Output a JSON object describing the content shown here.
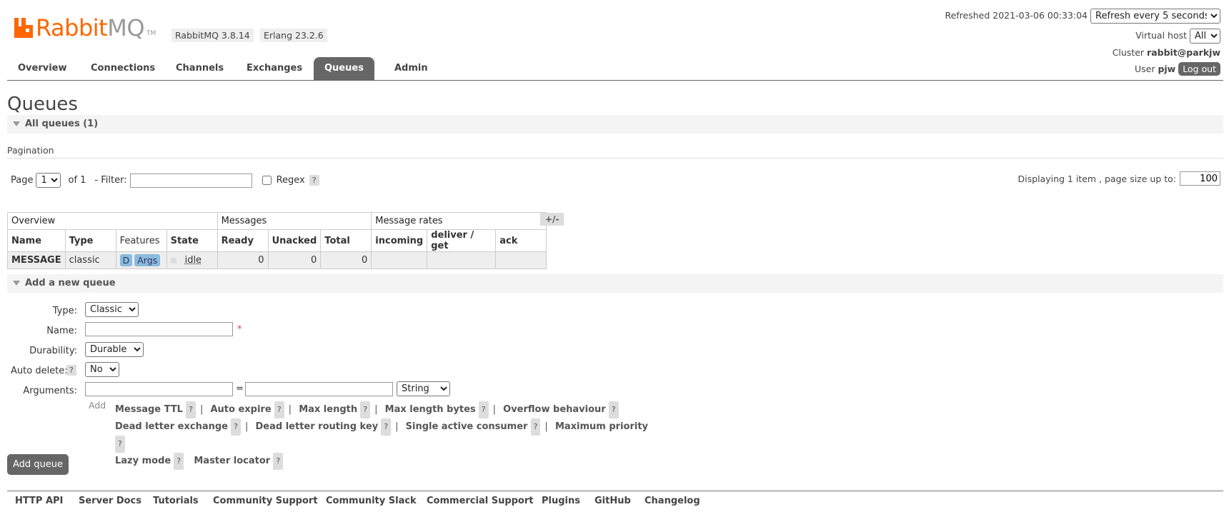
{
  "brand": {
    "rabbit": "Rabbit",
    "mq": "MQ",
    "tm": "TM",
    "primary_color": "#ff6600"
  },
  "versions": {
    "rabbitmq": "RabbitMQ 3.8.14",
    "erlang": "Erlang 23.2.6"
  },
  "header": {
    "refreshed": "Refreshed 2021-03-06 00:33:04",
    "refresh_option": "Refresh every 5 seconds",
    "vhost_label": "Virtual host",
    "vhost_value": "All",
    "cluster_label": "Cluster",
    "cluster_value": "rabbit@parkjw",
    "user_label": "User",
    "user_value": "pjw",
    "logout_label": "Log out"
  },
  "nav": {
    "tabs": [
      {
        "label": "Overview"
      },
      {
        "label": "Connections"
      },
      {
        "label": "Channels"
      },
      {
        "label": "Exchanges"
      },
      {
        "label": "Queues"
      },
      {
        "label": "Admin"
      }
    ],
    "active": "Queues"
  },
  "page": {
    "title": "Queues",
    "all_queues": "All queues (1)"
  },
  "pagination": {
    "section_label": "Pagination",
    "page_label": "Page",
    "page_value": "1",
    "of_label": "of 1",
    "filter_label": "- Filter:",
    "filter_value": "",
    "regex_label": "Regex",
    "help": "?",
    "displaying": "Displaying 1 item , page size up to:",
    "page_size": "100"
  },
  "table": {
    "groups": [
      "Overview",
      "Messages",
      "Message rates"
    ],
    "plusminus": "+/-",
    "headers": [
      "Name",
      "Type",
      "Features",
      "State",
      "Ready",
      "Unacked",
      "Total",
      "incoming",
      "deliver / get",
      "ack"
    ],
    "rows": [
      {
        "name": "MESSAGE",
        "type": "classic",
        "feature_d": "D",
        "feature_args": "Args",
        "state": "idle",
        "ready": "0",
        "unacked": "0",
        "total": "0",
        "incoming": "",
        "deliver_get": "",
        "ack": ""
      }
    ]
  },
  "add_queue": {
    "section_label": "Add a new queue",
    "type_label": "Type:",
    "type_value": "Classic",
    "name_label": "Name:",
    "name_value": "",
    "required_mark": "*",
    "durability_label": "Durability:",
    "durability_value": "Durable",
    "auto_delete_label": "Auto delete:",
    "auto_delete_value": "No",
    "arguments_label": "Arguments:",
    "equals": "=",
    "arg_type_value": "String",
    "add_label": "Add",
    "help": "?",
    "arg_links": [
      "Message TTL",
      "Auto expire",
      "Max length",
      "Max length bytes",
      "Overflow behaviour",
      "Dead letter exchange",
      "Dead letter routing key",
      "Single active consumer",
      "Maximum priority",
      "Lazy mode",
      "Master locator"
    ],
    "separator": "|",
    "submit_label": "Add queue"
  },
  "footer": {
    "links": [
      "HTTP API",
      "Server Docs",
      "Tutorials",
      "Community Support",
      "Community Slack",
      "Commercial Support",
      "Plugins",
      "GitHub",
      "Changelog"
    ]
  }
}
